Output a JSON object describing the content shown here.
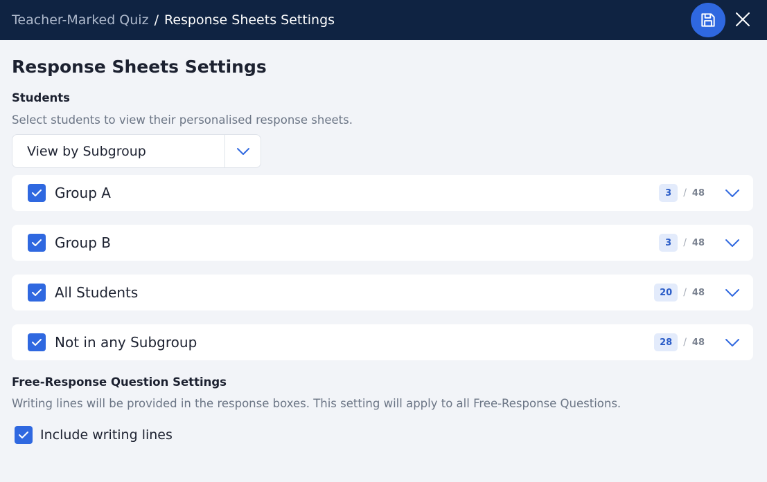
{
  "header": {
    "breadcrumb_parent": "Teacher-Marked Quiz",
    "breadcrumb_separator": "/",
    "breadcrumb_current": "Response Sheets Settings",
    "save_icon": "floppy-disk-icon",
    "close_icon": "close-icon"
  },
  "page": {
    "title": "Response Sheets Settings"
  },
  "students": {
    "title": "Students",
    "description": "Select students to view their personalised response sheets.",
    "view_select": {
      "value": "View by Subgroup"
    },
    "groups": [
      {
        "name": "Group A",
        "selected": "3",
        "total": "48",
        "checked": true
      },
      {
        "name": "Group B",
        "selected": "3",
        "total": "48",
        "checked": true
      },
      {
        "name": "All Students",
        "selected": "20",
        "total": "48",
        "checked": true
      },
      {
        "name": "Not in any Subgroup",
        "selected": "28",
        "total": "48",
        "checked": true
      }
    ],
    "count_separator": "/"
  },
  "free_response": {
    "title": "Free-Response Question Settings",
    "description": "Writing lines will be provided in the response boxes. This setting will apply to all Free-Response Questions.",
    "include_writing_lines": {
      "label": "Include writing lines",
      "checked": true
    }
  },
  "colors": {
    "header_bg": "#0f2342",
    "accent": "#2f68e0",
    "page_bg": "#f2f4f8",
    "badge_bg": "#e3ebfb"
  }
}
